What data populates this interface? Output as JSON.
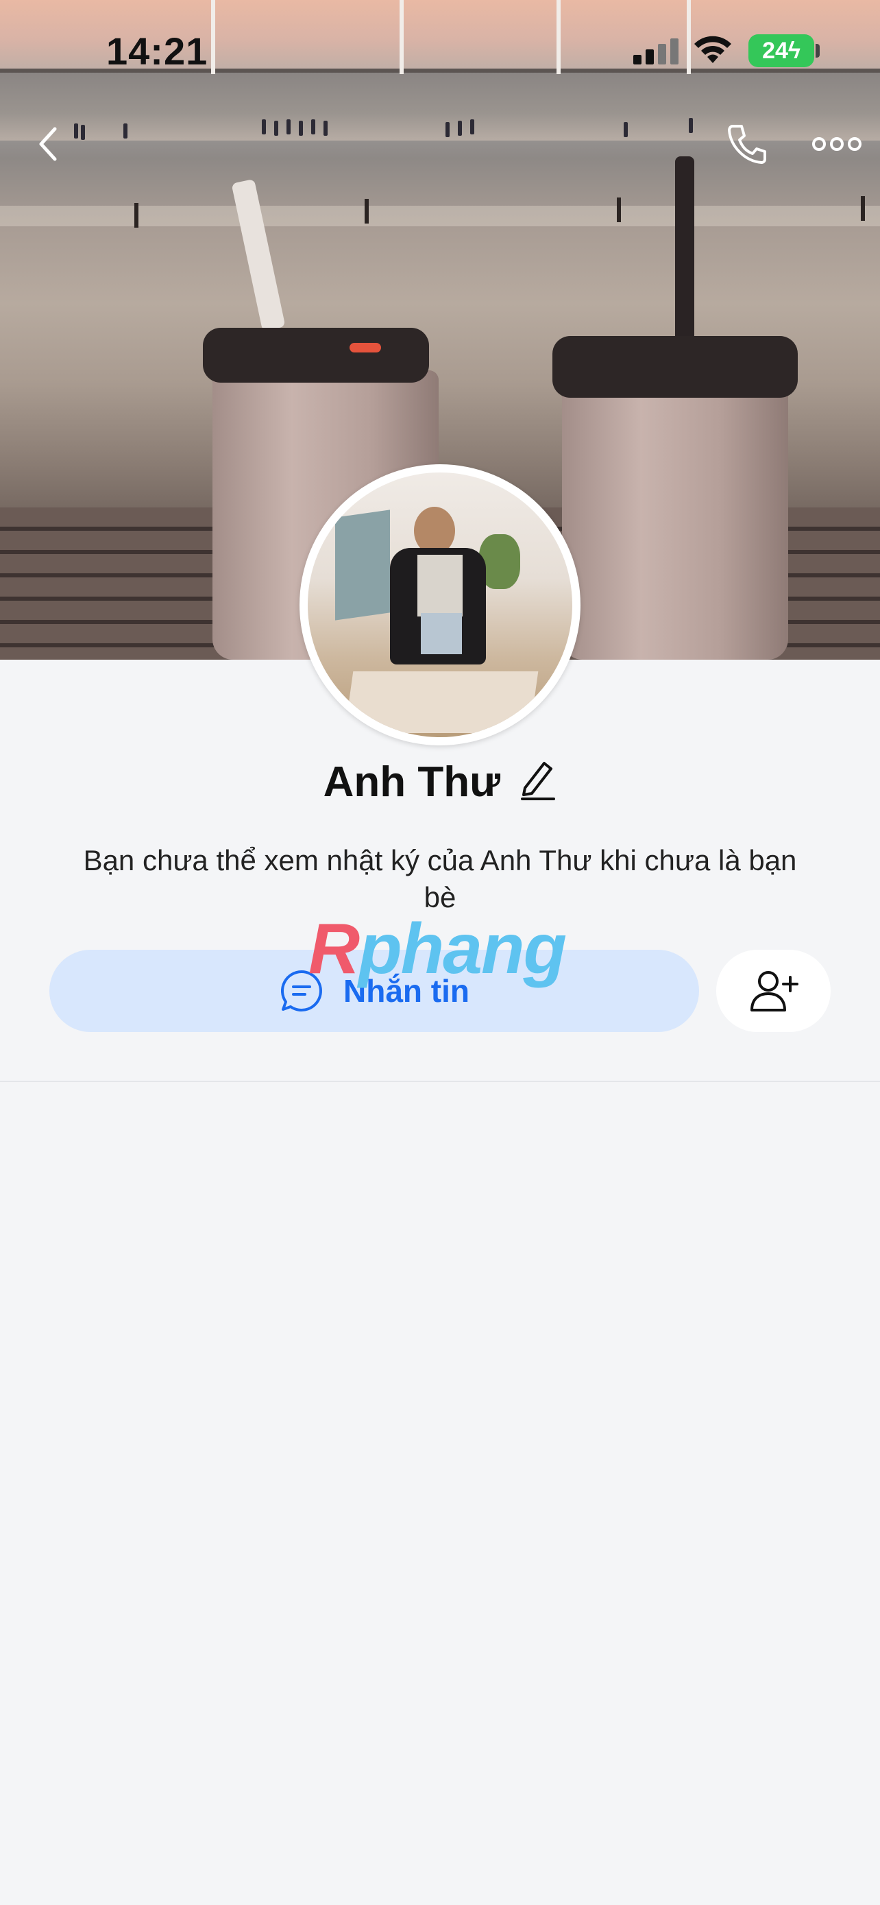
{
  "status_bar": {
    "time": "14:21",
    "battery": "24"
  },
  "nav": {
    "back_icon": "chevron-left-icon",
    "call_icon": "phone-icon",
    "more_icon": "more-dots-icon"
  },
  "profile": {
    "name": "Anh Thư",
    "edit_icon": "pencil-icon",
    "info_message": "Bạn chưa thể xem nhật ký của Anh Thư khi chưa là bạn bè"
  },
  "actions": {
    "message_label": "Nhắn tin",
    "message_icon": "chat-bubble-icon",
    "add_friend_icon": "add-friend-icon"
  },
  "watermark": {
    "first": "R",
    "rest": "phang"
  },
  "colors": {
    "accent": "#1a6bf0",
    "message_bg": "#d8e7fd",
    "page_bg": "#f4f5f7",
    "battery": "#34c759"
  }
}
